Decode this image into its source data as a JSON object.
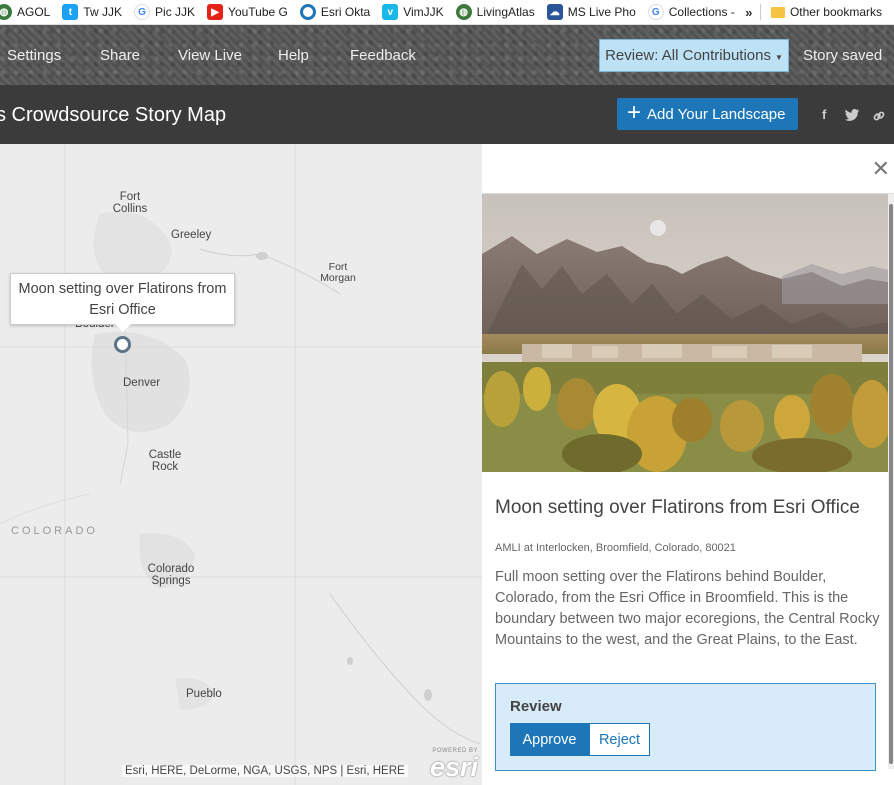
{
  "bookmarks": {
    "items": [
      {
        "label": "AGOL",
        "icon": "globe-icon",
        "color": "#3c7a3c"
      },
      {
        "label": "Tw JJK",
        "icon": "twitter-icon",
        "color": "#1da1f2"
      },
      {
        "label": "Pic JJK",
        "icon": "google-icon",
        "color": "#4285f4"
      },
      {
        "label": "YouTube G",
        "icon": "youtube-icon",
        "color": "#e62117"
      },
      {
        "label": "Esri Okta",
        "icon": "okta-icon",
        "color": "#1d76b8"
      },
      {
        "label": "VimJJK",
        "icon": "vimeo-icon",
        "color": "#1ab7ea"
      },
      {
        "label": "LivingAtlas",
        "icon": "globe-icon",
        "color": "#3c7a3c"
      },
      {
        "label": "MS Live Pho",
        "icon": "cloud-icon",
        "color": "#2a5699"
      },
      {
        "label": "Collections - Google Pho",
        "icon": "google-icon",
        "color": "#4285f4"
      }
    ],
    "more": "»",
    "other": "Other bookmarks"
  },
  "toolbar": {
    "settings": "Settings",
    "share": "Share",
    "view_live": "View Live",
    "help": "Help",
    "feedback": "Feedback",
    "review_dropdown": "Review: All Contributions",
    "status": "Story saved"
  },
  "header": {
    "title": "s Crowdsource Story Map",
    "add_button": "Add Your Landscape",
    "share_icons": [
      "facebook-icon",
      "twitter-icon",
      "link-icon"
    ]
  },
  "map": {
    "cities": {
      "fort_collins": "Fort Collins",
      "greeley": "Greeley",
      "fort_morgan": "Fort Morgan",
      "boulder": "Boulder",
      "denver": "Denver",
      "castle_rock": "Castle Rock",
      "colorado_springs": "Colorado Springs",
      "pueblo": "Pueblo"
    },
    "state_label": "COLORADO",
    "popup": "Moon setting over Flatirons from Esri Office",
    "attribution": "Esri, HERE, DeLorme, NGA, USGS, NPS | Esri, HERE",
    "logo_powered": "POWERED BY",
    "logo": "esri"
  },
  "entry": {
    "title": "Moon setting over Flatirons from Esri Office",
    "location": "AMLI at Interlocken, Broomfield, Colorado, 80021",
    "description": "Full moon setting over the Flatirons behind Boulder, Colorado, from the Esri Office in Broomfield. This is the boundary between two major ecoregions, the Central Rocky Mountains to the west, and the Great Plains, to the East.",
    "review_label": "Review",
    "approve": "Approve",
    "reject": "Reject"
  },
  "colors": {
    "accent": "#1d76b8",
    "review_bg": "#d7ecf8",
    "title_bar": "#3b3b3b"
  }
}
